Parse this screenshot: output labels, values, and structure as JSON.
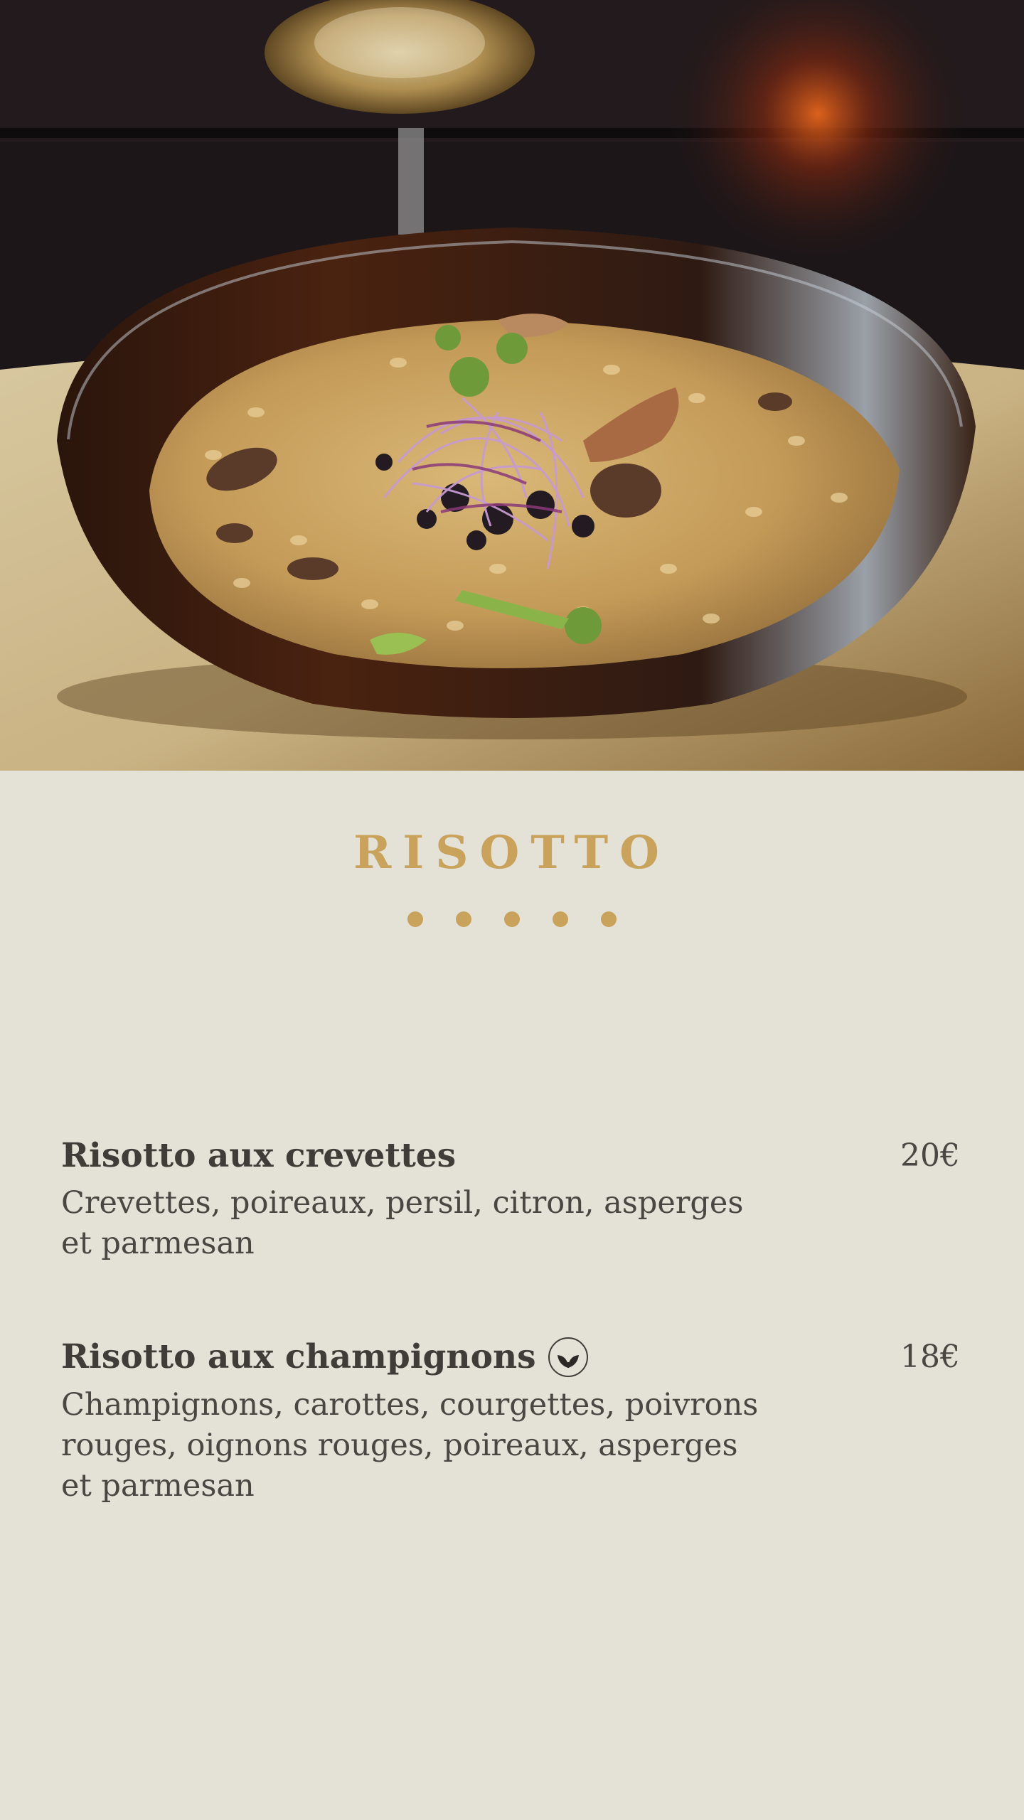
{
  "section": {
    "title": "RISOTTO",
    "accent_color": "#c9a25c",
    "background_color": "#e4e1d7",
    "divider_dot_count": 5
  },
  "hero": {
    "image_icon": "risotto-bowl-photo"
  },
  "items": [
    {
      "name": "Risotto aux crevettes",
      "description": "Crevettes, poireaux, persil, citron, asperges et parmesan",
      "price": "20€",
      "vegetarian": false
    },
    {
      "name": "Risotto aux champignons",
      "description": "Champignons, carottes, courgettes, poivrons rouges, oignons rouges, poireaux, asperges et parmesan",
      "price": "18€",
      "vegetarian": true,
      "badge_icon": "leaf-icon"
    }
  ]
}
